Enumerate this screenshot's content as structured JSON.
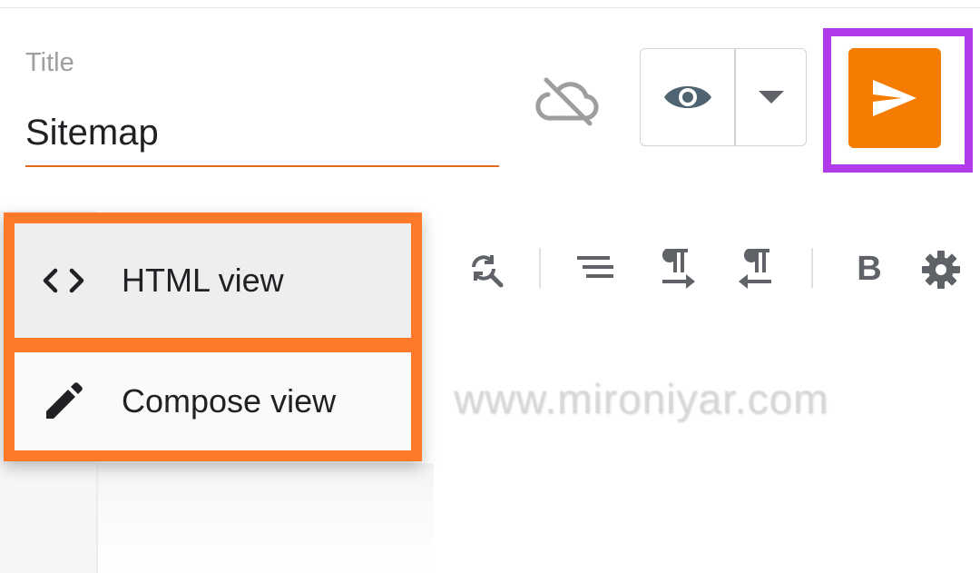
{
  "post": {
    "title_label": "Title",
    "title_value": "Sitemap"
  },
  "header": {
    "cloud_icon": "cloud-off-icon",
    "preview_icon": "eye-icon",
    "dropdown_icon": "caret-down-icon",
    "publish_icon": "send-icon",
    "publish_color": "#f57c00",
    "highlight_color": "#b13aeb"
  },
  "toolbar": {
    "icons": [
      "find-replace-icon",
      "align-icon",
      "ltr-icon",
      "rtl-icon",
      "bold-icon",
      "settings-icon"
    ],
    "bold_glyph": "B"
  },
  "mode_menu": {
    "highlight_color": "#fe7a2a",
    "items": [
      {
        "label": "HTML view",
        "icon": "code-icon",
        "glyph": "<>"
      },
      {
        "label": "Compose view",
        "icon": "pencil-icon"
      }
    ]
  },
  "watermark": "www.mironiyar.com"
}
